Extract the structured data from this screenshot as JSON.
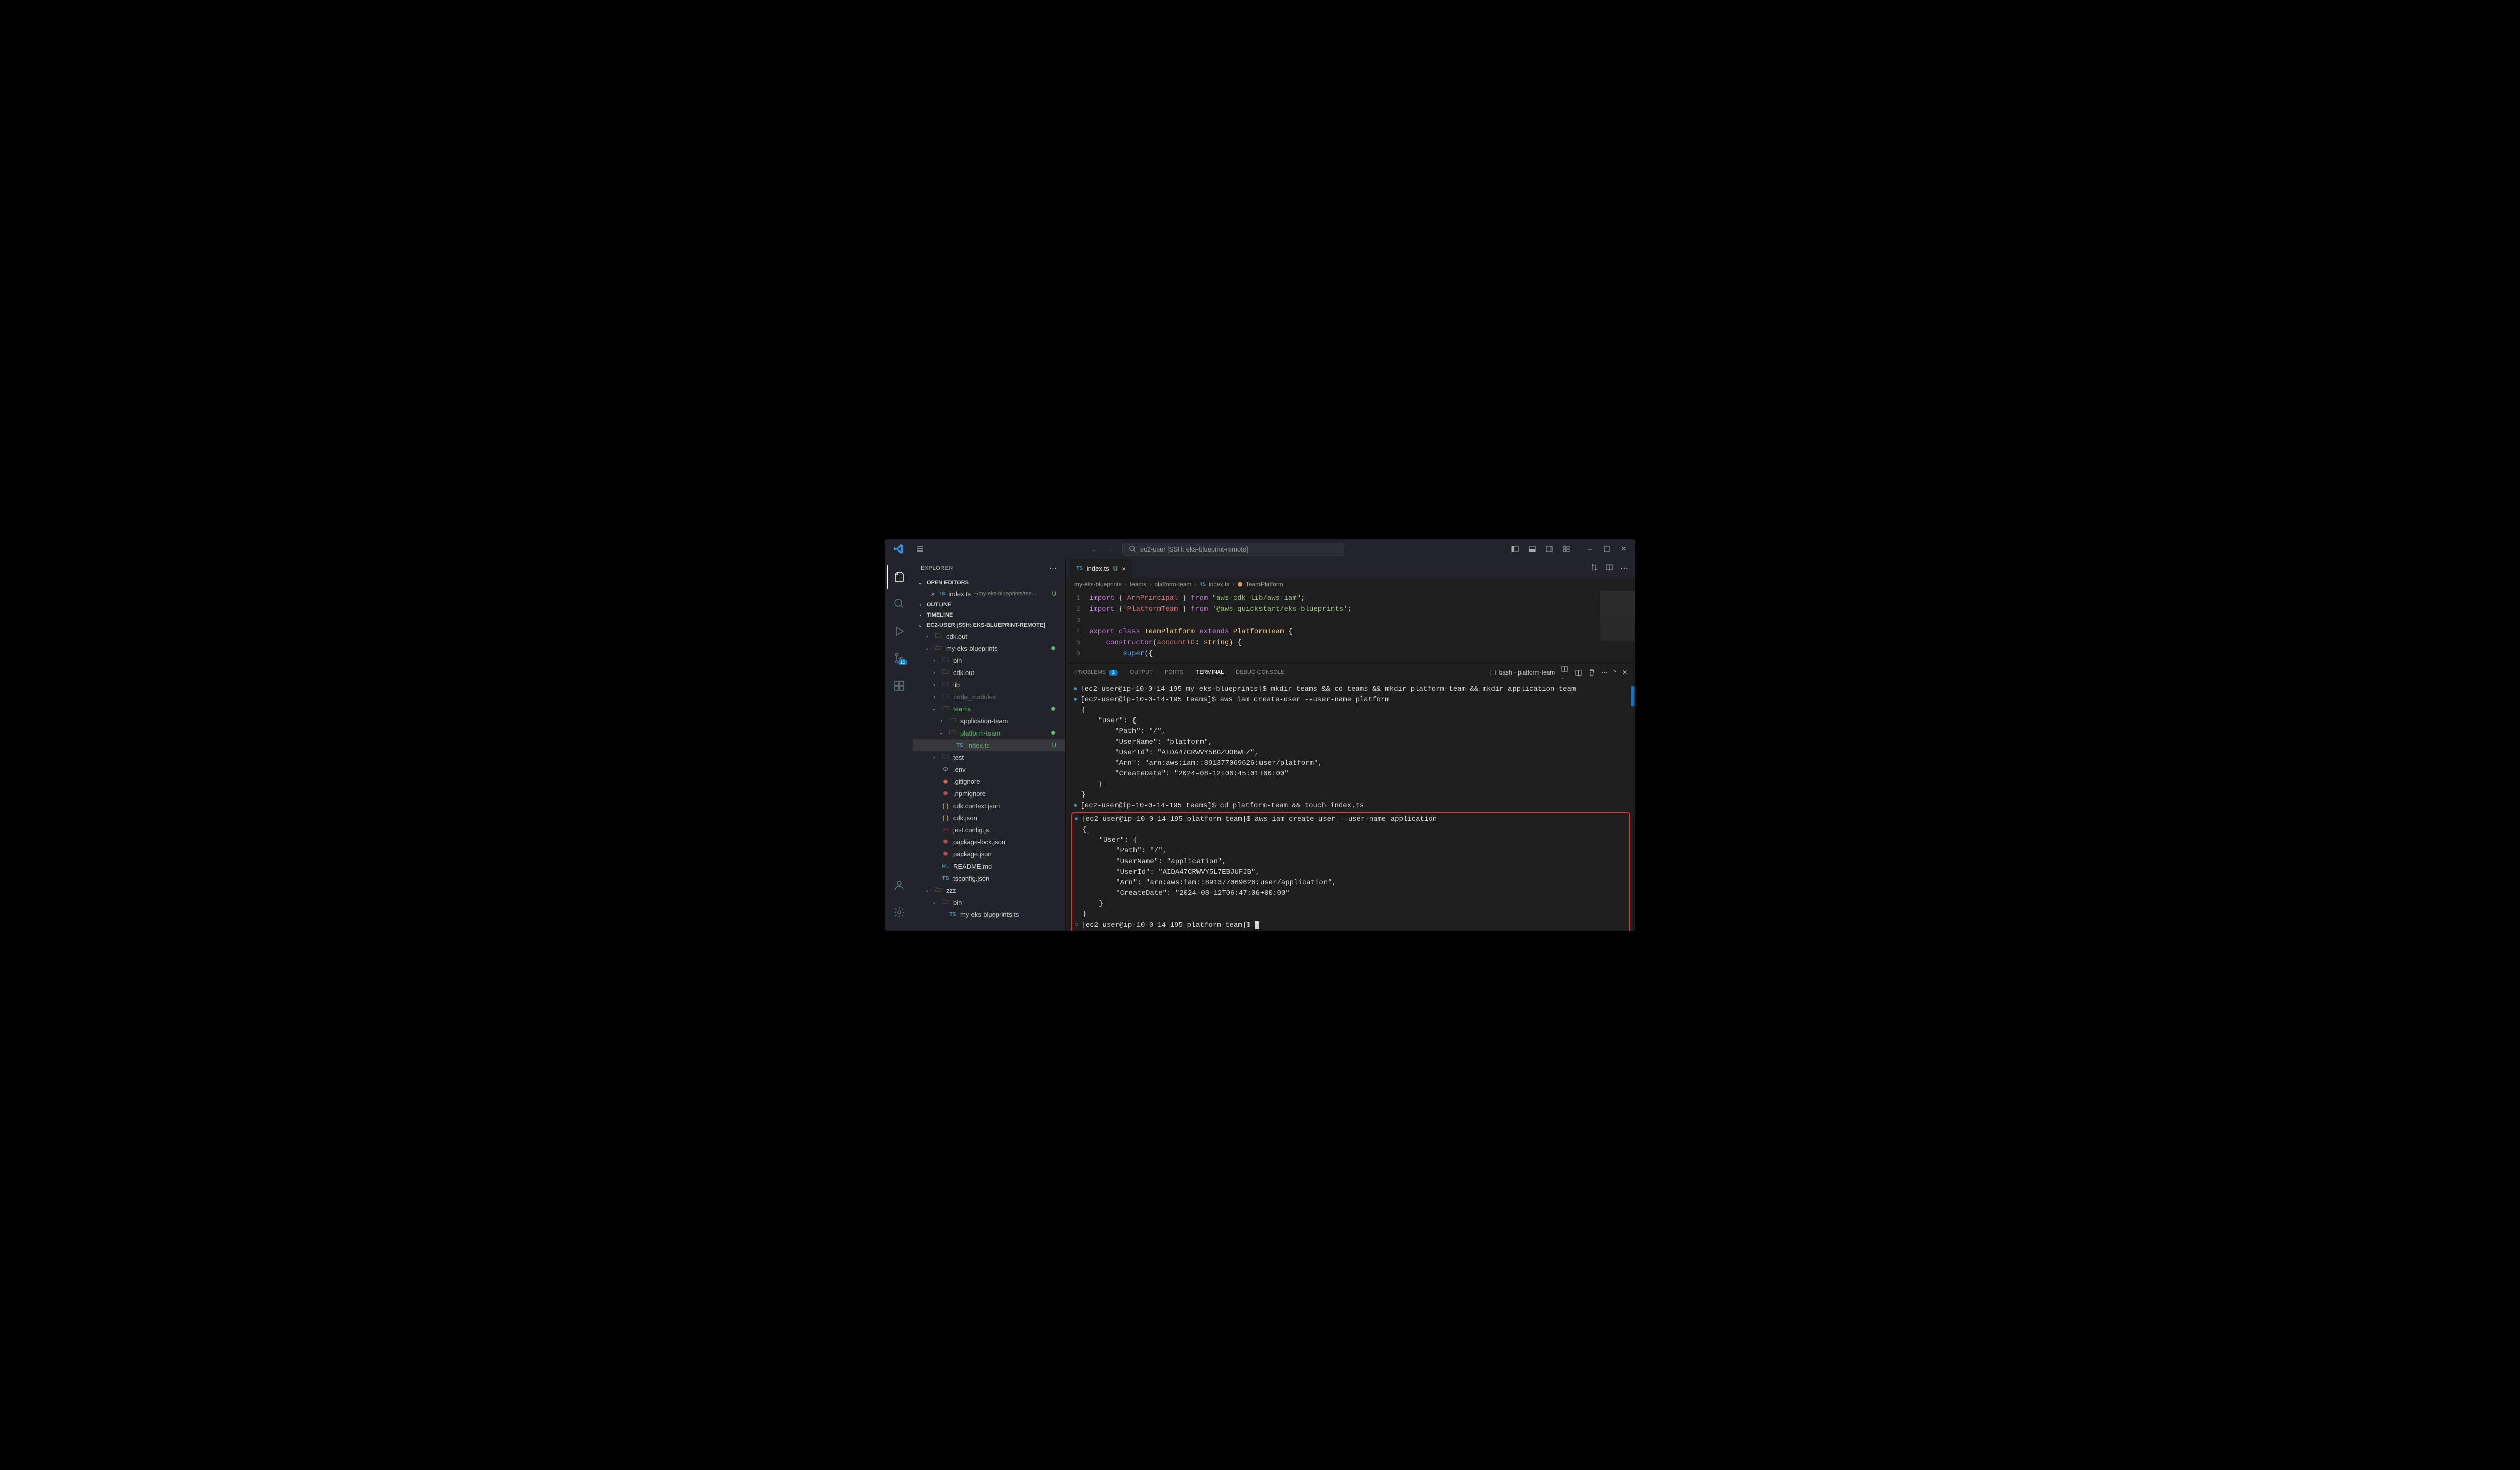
{
  "titlebar": {
    "search_text": "ec2-user [SSH: eks-blueprint-remote]"
  },
  "sidebar": {
    "title": "EXPLORER",
    "sections": {
      "open_editors": "OPEN EDITORS",
      "outline": "OUTLINE",
      "timeline": "TIMELINE",
      "workspace": "EC2-USER [SSH: EKS-BLUEPRINT-REMOTE]"
    },
    "open_file": {
      "name": "index.ts",
      "path": "~/my-eks-blueprints/tea...",
      "status": "U"
    },
    "tree": [
      {
        "name": "cdk.out",
        "type": "folder",
        "indent": 1,
        "expanded": false
      },
      {
        "name": "my-eks-blueprints",
        "type": "folder",
        "indent": 1,
        "expanded": true,
        "git": "dot"
      },
      {
        "name": "bin",
        "type": "folder",
        "indent": 2,
        "expanded": false,
        "iconRed": true
      },
      {
        "name": "cdk.out",
        "type": "folder",
        "indent": 2,
        "expanded": false
      },
      {
        "name": "lib",
        "type": "folder",
        "indent": 2,
        "expanded": false,
        "iconRed": true
      },
      {
        "name": "node_modules",
        "type": "folder",
        "indent": 2,
        "expanded": false,
        "grey": true
      },
      {
        "name": "teams",
        "type": "folder",
        "indent": 2,
        "expanded": true,
        "green": true,
        "git": "dot"
      },
      {
        "name": "application-team",
        "type": "folder",
        "indent": 3,
        "expanded": false
      },
      {
        "name": "platform-team",
        "type": "folder",
        "indent": 3,
        "expanded": true,
        "green": true,
        "git": "dot"
      },
      {
        "name": "index.ts",
        "type": "file",
        "indent": 4,
        "icon": "ts",
        "green": true,
        "git": "U",
        "selected": true
      },
      {
        "name": "test",
        "type": "folder",
        "indent": 2,
        "expanded": false,
        "iconRed": true
      },
      {
        "name": ".env",
        "type": "file",
        "indent": 2,
        "icon": "gear"
      },
      {
        "name": ".gitignore",
        "type": "file",
        "indent": 2,
        "icon": "git"
      },
      {
        "name": ".npmignore",
        "type": "file",
        "indent": 2,
        "icon": "npm"
      },
      {
        "name": "cdk.context.json",
        "type": "file",
        "indent": 2,
        "icon": "json"
      },
      {
        "name": "cdk.json",
        "type": "file",
        "indent": 2,
        "icon": "json"
      },
      {
        "name": "jest.config.js",
        "type": "file",
        "indent": 2,
        "icon": "js"
      },
      {
        "name": "package-lock.json",
        "type": "file",
        "indent": 2,
        "icon": "npm"
      },
      {
        "name": "package.json",
        "type": "file",
        "indent": 2,
        "icon": "npm"
      },
      {
        "name": "README.md",
        "type": "file",
        "indent": 2,
        "icon": "md"
      },
      {
        "name": "tsconfig.json",
        "type": "file",
        "indent": 2,
        "icon": "ts"
      },
      {
        "name": "zzz",
        "type": "folder",
        "indent": 1,
        "expanded": true
      },
      {
        "name": "bin",
        "type": "folder",
        "indent": 2,
        "expanded": true,
        "iconRed": true
      },
      {
        "name": "my-eks-blueprints.ts",
        "type": "file",
        "indent": 3,
        "icon": "ts",
        "truncated": true
      }
    ]
  },
  "editor": {
    "tab": {
      "name": "index.ts",
      "status": "U"
    },
    "breadcrumbs": [
      "my-eks-blueprints",
      "teams",
      "platform-team",
      "index.ts",
      "TeamPlatform"
    ],
    "code": [
      {
        "n": 1,
        "html": "<span class='k-purple'>import</span> <span class='k-white'>{ </span><span class='k-red'>ArnPrincipal</span><span class='k-white'> } </span><span class='k-purple'>from</span> <span class='k-green'>\"aws-cdk-lib/aws-iam\"</span><span class='k-white'>;</span>"
      },
      {
        "n": 2,
        "html": "<span class='k-purple'>import</span> <span class='k-white'>{ </span><span class='k-red'>PlatformTeam</span><span class='k-white'> } </span><span class='k-purple'>from</span> <span class='k-green'>'@aws-quickstart/eks-blueprints'</span><span class='k-white'>;</span>"
      },
      {
        "n": 3,
        "html": ""
      },
      {
        "n": 4,
        "html": "<span class='k-purple'>export</span> <span class='k-purple'>class</span> <span class='k-yellow'>TeamPlatform</span><span class='k-white'> </span><span class='k-purple'>extends</span><span class='k-white'> </span><span class='k-yellow'>PlatformTeam</span><span class='k-white'> {</span>"
      },
      {
        "n": 5,
        "html": "    <span class='k-purple'>constructor</span><span class='k-white'>(</span><span class='k-red'>accountID</span><span class='k-white'>: </span><span class='k-yellow'>string</span><span class='k-white'>) {</span>"
      },
      {
        "n": 6,
        "html": "        <span class='k-blue'>super</span><span class='k-white'>({</span>"
      }
    ]
  },
  "panel": {
    "tabs": {
      "problems": "PROBLEMS",
      "problems_badge": "1",
      "output": "OUTPUT",
      "ports": "PORTS",
      "terminal": "TERMINAL",
      "debug": "DEBUG CONSOLE"
    },
    "shell_label": "bash - platform-team",
    "terminal_blocks": [
      {
        "bullet": "blue",
        "lines": [
          "[ec2-user@ip-10-0-14-195 my-eks-blueprints]$ mkdir teams && cd teams && mkdir platform-team && mkdir application-team"
        ]
      },
      {
        "bullet": "blue",
        "lines": [
          "[ec2-user@ip-10-0-14-195 teams]$ aws iam create-user --user-name platform",
          "{",
          "    \"User\": {",
          "        \"Path\": \"/\",",
          "        \"UserName\": \"platform\",",
          "        \"UserId\": \"AIDA47CRWVY5BGZUOBWEZ\",",
          "        \"Arn\": \"arn:aws:iam::891377069626:user/platform\",",
          "        \"CreateDate\": \"2024-08-12T06:45:01+00:00\"",
          "    }",
          "}"
        ]
      },
      {
        "bullet": "blue",
        "lines": [
          "[ec2-user@ip-10-0-14-195 teams]$ cd platform-team && touch index.ts"
        ]
      },
      {
        "bullet": "blue",
        "highlight": true,
        "lines": [
          "[ec2-user@ip-10-0-14-195 platform-team]$ aws iam create-user --user-name application",
          "{",
          "    \"User\": {",
          "        \"Path\": \"/\",",
          "        \"UserName\": \"application\",",
          "        \"UserId\": \"AIDA47CRWVY5L7EBJUFJB\",",
          "        \"Arn\": \"arn:aws:iam::891377069626:user/application\",",
          "        \"CreateDate\": \"2024-08-12T06:47:06+00:00\"",
          "    }",
          "}"
        ],
        "followup": {
          "bullet": "grey",
          "text": "[ec2-user@ip-10-0-14-195 platform-team]$ ",
          "cursor": true
        }
      }
    ]
  }
}
